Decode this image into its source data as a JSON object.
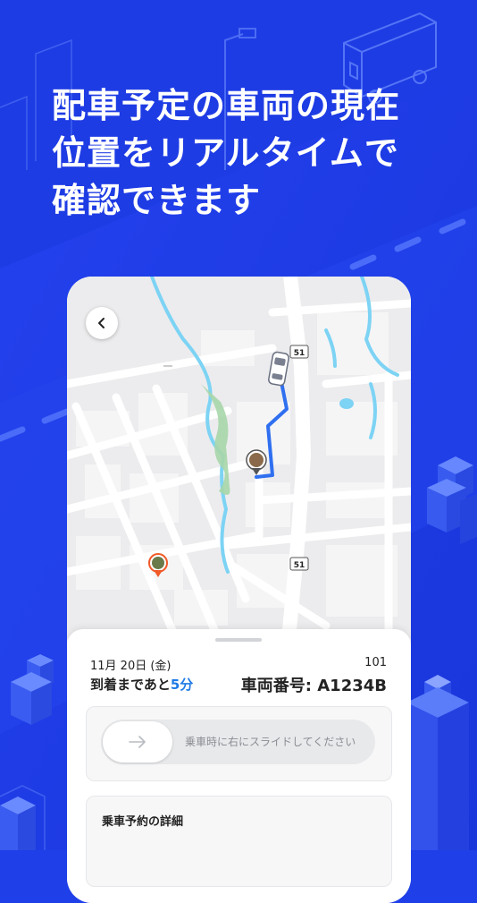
{
  "headline": {
    "line1": "配車予定の車両の現在",
    "line2": "位置をリアルタイムで",
    "line3": "確認できます"
  },
  "map": {
    "route_badge_top": "51",
    "route_badge_bottom": "51"
  },
  "booking": {
    "date": "11月 20日 (金)",
    "room": "101",
    "eta_prefix": "到着まであと",
    "eta_value": "5分",
    "plate_label": "車両番号: A1234B"
  },
  "slider": {
    "hint": "乗車時に右にスライドしてください"
  },
  "details": {
    "title": "乗車予約の詳細"
  },
  "colors": {
    "background": "#1f3fe8",
    "route": "#2f6ff0",
    "eta_accent": "#1e7ae6",
    "pin": "#f05a28"
  },
  "icons": {
    "back": "chevron-left-icon",
    "slider": "arrow-right-icon",
    "vehicle": "car-icon",
    "pickup": "pickup-pin-icon",
    "destination": "destination-pin-icon"
  }
}
